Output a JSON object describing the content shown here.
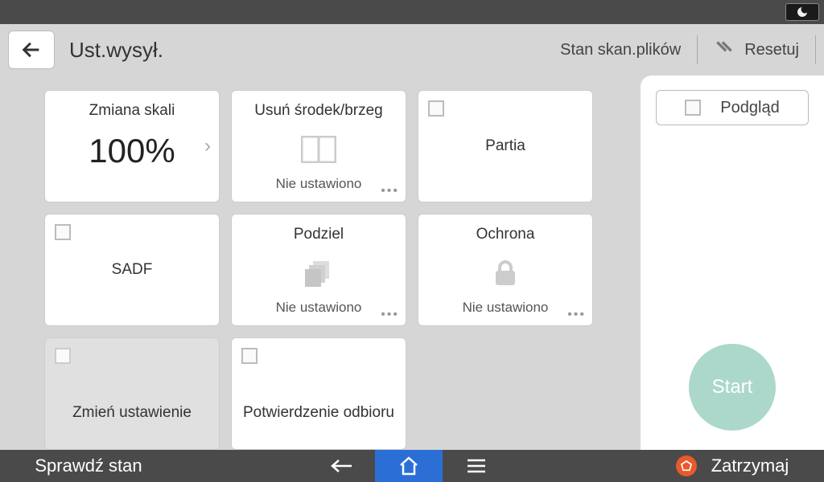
{
  "header": {
    "title": "Ust.wysył.",
    "scan_status": "Stan skan.plików",
    "reset": "Resetuj"
  },
  "tiles": {
    "scale": {
      "title": "Zmiana skali",
      "value": "100%"
    },
    "erase": {
      "title": "Usuń środek/brzeg",
      "status": "Nie ustawiono"
    },
    "batch": {
      "label": "Partia"
    },
    "sadf": {
      "label": "SADF"
    },
    "divide": {
      "title": "Podziel",
      "status": "Nie ustawiono"
    },
    "protect": {
      "title": "Ochrona",
      "status": "Nie ustawiono"
    },
    "change": {
      "label": "Zmień ustawienie"
    },
    "confirm": {
      "label": "Potwierdzenie odbioru"
    }
  },
  "side": {
    "preview": "Podgląd",
    "start": "Start"
  },
  "bottom": {
    "status": "Sprawdź stan",
    "stop": "Zatrzymaj"
  }
}
